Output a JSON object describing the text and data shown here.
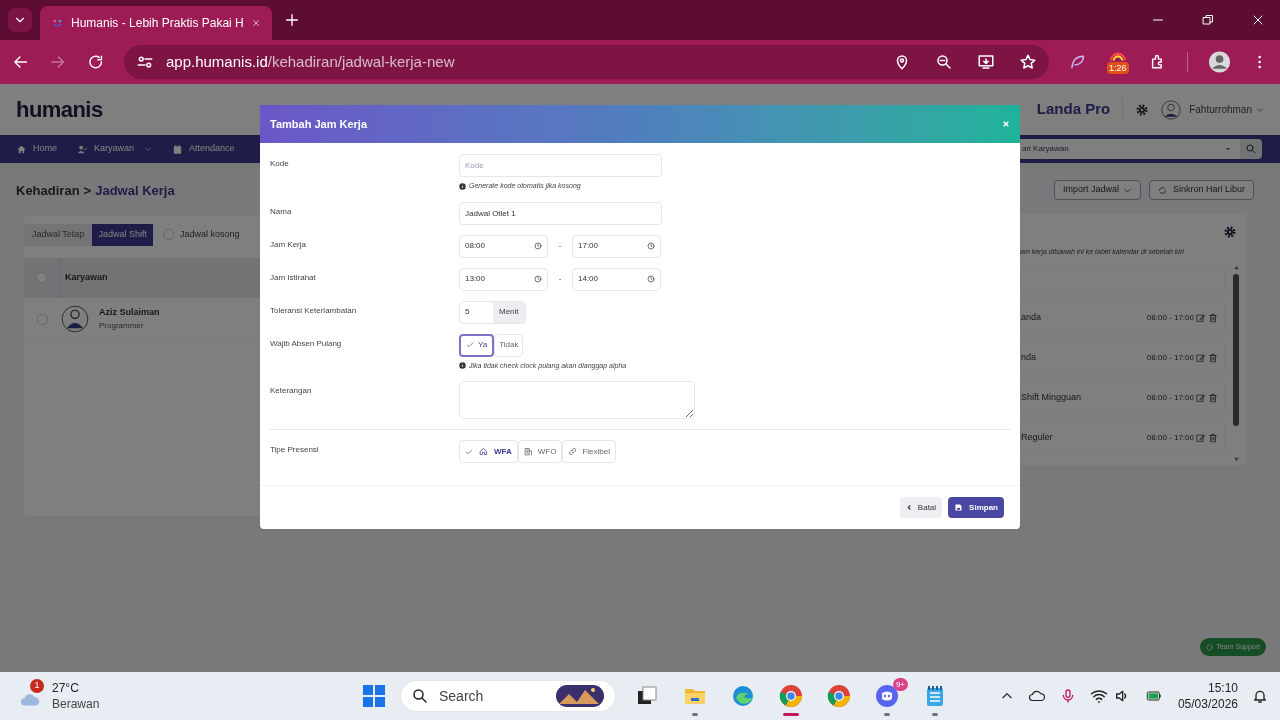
{
  "browser": {
    "tab_title": "Humanis - Lebih Praktis Pakai H",
    "url_host": "app.humanis.id",
    "url_path": "/kehadiran/jadwal-kerja-new",
    "extension_badge": "1:26"
  },
  "header": {
    "logo": "humanis",
    "brand": "Landa Pro",
    "user": "Fahturrohman"
  },
  "nav": {
    "items": [
      {
        "label": "Home",
        "dropdown": false
      },
      {
        "label": "Karyawan",
        "dropdown": true
      },
      {
        "label": "Attendance",
        "dropdown": false
      }
    ],
    "search_placeholder": "ari Karyawan"
  },
  "breadcrumb": {
    "parent": "Kehadiran",
    "separator": ">",
    "current": "Jadwal Kerja"
  },
  "tabs": [
    {
      "label": "Jadwal Tetap",
      "selected": false
    },
    {
      "label": "Jadwal Shift",
      "selected": true
    }
  ],
  "empty_filter": {
    "label": "Jadwal kosong",
    "checked": false
  },
  "table": {
    "select_all_checked": false,
    "columns": [
      "Karyawan"
    ],
    "rows": [
      {
        "name": "Aziz Sulaiman",
        "role": "Programmer",
        "checked": false
      }
    ]
  },
  "actions": [
    "Import Jadwal",
    "Sinkron Hari Libur"
  ],
  "schedule_panel": {
    "hint": "am kerja dibawah ini ke tabel kalendar di sebelah kiri",
    "items": [
      {
        "kind": "blank"
      },
      {
        "kind": "shift",
        "name": "anda",
        "time": "08:00 - 17:00"
      },
      {
        "kind": "shift",
        "name": "nda",
        "time": "08:00 - 17:00"
      },
      {
        "kind": "shift",
        "name": "Shift Mingguan",
        "time": "08:00 - 17:00"
      },
      {
        "kind": "shift",
        "name": "Reguler",
        "time": "08:00 - 17:00"
      }
    ]
  },
  "support_button": "Team Support",
  "modal": {
    "title": "Tambah Jam Kerja",
    "fields": [
      {
        "kind": "text",
        "label": "Kode",
        "placeholder": "Kode",
        "help": "Generate kode otomatis jika kosong"
      },
      {
        "kind": "text",
        "label": "Nama",
        "value": "Jadwal Otlet 1"
      },
      {
        "kind": "time_range",
        "label": "Jam Kerja",
        "from": "08:00",
        "separator": "-",
        "to": "17:00"
      },
      {
        "kind": "time_range",
        "label": "Jam Istirahat",
        "from": "13:00",
        "separator": "-",
        "to": "14:00"
      },
      {
        "kind": "number_unit",
        "label": "Toleransi Keterlambatan",
        "value": "5",
        "unit": "Menit"
      },
      {
        "kind": "toggle",
        "label": "Wajib Absen Pulang",
        "options": [
          {
            "label": "Ya",
            "selected": true
          },
          {
            "label": "Tidak",
            "selected": false
          }
        ],
        "help": "Jika tidak check clock pulang akan dianggap alpha"
      },
      {
        "kind": "textarea",
        "label": "Keterangan"
      },
      {
        "kind": "option_group",
        "label": "Tipe Presensi",
        "options": [
          {
            "label": "WFA",
            "selected": true
          },
          {
            "label": "WFO",
            "selected": false
          },
          {
            "label": "Flexibel",
            "selected": false
          }
        ]
      }
    ],
    "buttons": [
      {
        "kind": "cancel",
        "label": "Batal"
      },
      {
        "kind": "save",
        "label": "Simpan"
      }
    ]
  },
  "taskbar": {
    "weather_badge": "1",
    "temperature": "27°C",
    "condition": "Berawan",
    "search": "Search",
    "discord_badge": "9+",
    "time": "15:10",
    "date": "05/03/2026"
  }
}
